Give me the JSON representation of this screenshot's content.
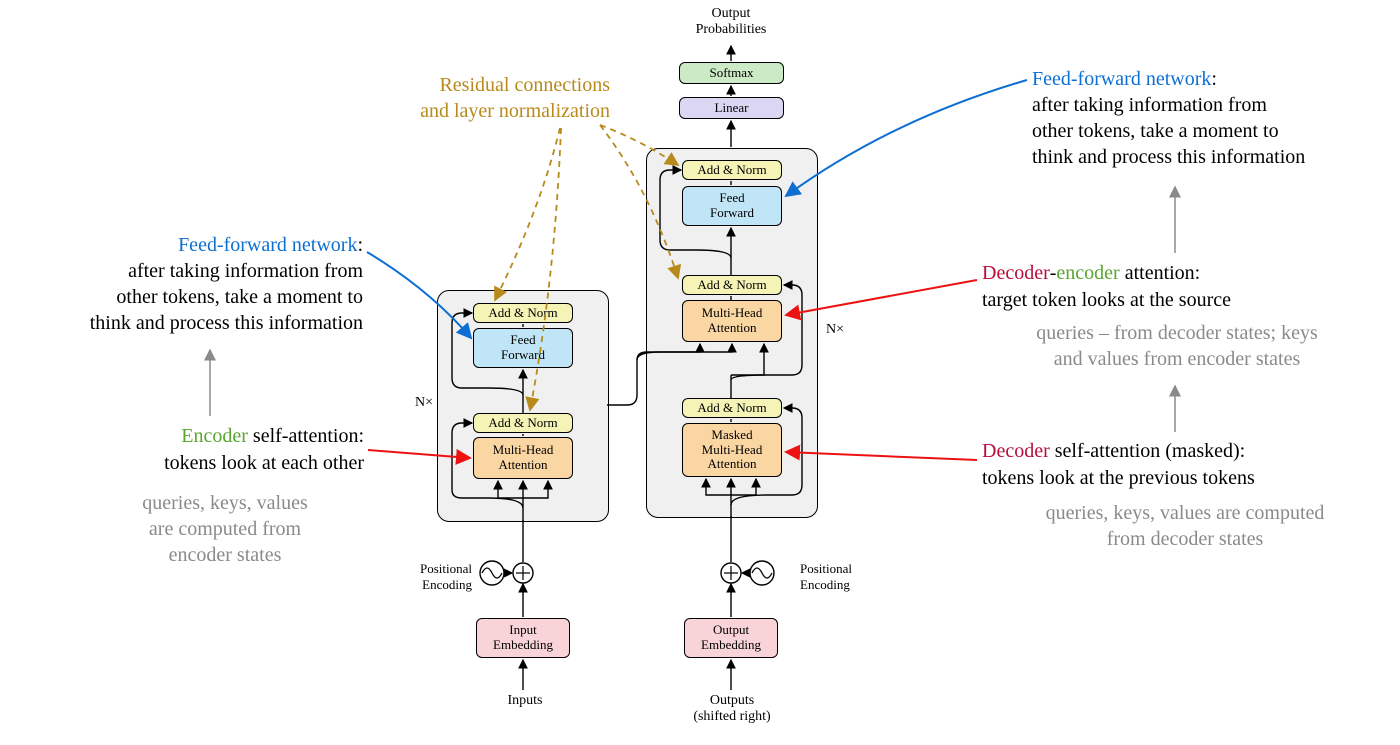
{
  "top": {
    "output_label_line1": "Output",
    "output_label_line2": "Probabilities",
    "softmax": "Softmax",
    "linear": "Linear"
  },
  "encoder": {
    "addnorm2": "Add & Norm",
    "feedforward_line1": "Feed",
    "feedforward_line2": "Forward",
    "addnorm1": "Add & Norm",
    "attn_line1": "Multi-Head",
    "attn_line2": "Attention",
    "repeat": "N×",
    "posenc": "Positional",
    "posenc2": "Encoding",
    "embed_line1": "Input",
    "embed_line2": "Embedding",
    "inputs": "Inputs"
  },
  "decoder": {
    "addnorm3": "Add & Norm",
    "feedforward_line1": "Feed",
    "feedforward_line2": "Forward",
    "addnorm2": "Add & Norm",
    "crossattn_line1": "Multi-Head",
    "crossattn_line2": "Attention",
    "addnorm1": "Add & Norm",
    "maskedattn_line1": "Masked",
    "maskedattn_line2": "Multi-Head",
    "maskedattn_line3": "Attention",
    "repeat": "N×",
    "posenc": "Positional",
    "posenc2": "Encoding",
    "embed_line1": "Output",
    "embed_line2": "Embedding",
    "outputs_line1": "Outputs",
    "outputs_line2": "(shifted right)"
  },
  "annotations": {
    "residual": {
      "line1": "Residual connections",
      "line2": "and layer normalization"
    },
    "encoder_ff": {
      "title": "Feed-forward network",
      "line1": "after taking information from",
      "line2": "other tokens, take a moment to",
      "line3": "think and process this information"
    },
    "encoder_self": {
      "title_prefix": "Encoder",
      "title_rest": " self-attention:",
      "sub": "tokens look at each other",
      "grey_line1": "queries, keys, values",
      "grey_line2": "are computed from",
      "grey_line3": "encoder states"
    },
    "decoder_ff": {
      "title": "Feed-forward network",
      "line1": "after taking information from",
      "line2": "other tokens, take a moment to",
      "line3": "think and process this information"
    },
    "decoder_cross": {
      "title_dec": "Decoder",
      "title_hyphen": "-",
      "title_enc": "encoder",
      "title_rest": " attention:",
      "sub": "target token looks at the source",
      "grey_line1": "queries – from decoder states; keys",
      "grey_line2": "and values from encoder states"
    },
    "decoder_self": {
      "title_prefix": "Decoder",
      "title_rest": " self-attention (masked):",
      "sub": "tokens look at the previous tokens",
      "grey_line1": "queries, keys, values are computed",
      "grey_line2": "from decoder states"
    }
  }
}
